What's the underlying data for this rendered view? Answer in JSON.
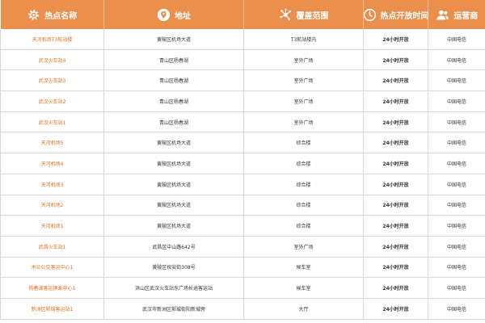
{
  "colors": {
    "header_bg": "#ea8f4c",
    "name_text": "#e46e1b",
    "body_text": "#333333",
    "border": "#d9d9d9"
  },
  "headers": [
    {
      "label": "热点名称",
      "icon": "gear-icon"
    },
    {
      "label": "地址",
      "icon": "location-pin-icon"
    },
    {
      "label": "覆盖范围",
      "icon": "coverage-network-icon"
    },
    {
      "label": "热点开放时间",
      "icon": "clock-icon"
    },
    {
      "label": "运营商",
      "icon": "users-icon"
    }
  ],
  "rows": [
    {
      "name": "天河机场T3航站楼",
      "address": "黄陂区机场大道",
      "coverage": "T3航站楼内",
      "hours": "24小时开放",
      "operator": "中国电信"
    },
    {
      "name": "武汉火车站4",
      "address": "青山区杨春湖",
      "coverage": "室外广场",
      "hours": "24小时开放",
      "operator": "中国电信"
    },
    {
      "name": "武汉火车站3",
      "address": "青山区杨春湖",
      "coverage": "室外广场",
      "hours": "24小时开放",
      "operator": "中国电信"
    },
    {
      "name": "武汉火车站2",
      "address": "青山区杨春湖",
      "coverage": "室外广场",
      "hours": "24小时开放",
      "operator": "中国电信"
    },
    {
      "name": "武汉火车站1",
      "address": "青山区杨春湖",
      "coverage": "室外广场",
      "hours": "24小时开放",
      "operator": "中国电信"
    },
    {
      "name": "天河机场5",
      "address": "黄陂区机场大道",
      "coverage": "综合楼",
      "hours": "24小时开放",
      "operator": "中国电信"
    },
    {
      "name": "天河机场4",
      "address": "黄陂区机场大道",
      "coverage": "综合楼",
      "hours": "24小时开放",
      "operator": "中国电信"
    },
    {
      "name": "天河机场3",
      "address": "黄陂区机场大道",
      "coverage": "综合楼",
      "hours": "24小时开放",
      "operator": "中国电信"
    },
    {
      "name": "天河机场2",
      "address": "黄陂区机场大道",
      "coverage": "综合楼",
      "hours": "24小时开放",
      "operator": "中国电信"
    },
    {
      "name": "天河机场1",
      "address": "黄陂区机场大道",
      "coverage": "综合楼",
      "hours": "24小时开放",
      "operator": "中国电信"
    },
    {
      "name": "武昌火车站1",
      "address": "武昌区中山路642号",
      "coverage": "室外广场",
      "hours": "24小时开放",
      "operator": "中国电信"
    },
    {
      "name": "木兰公交客运中心1",
      "address": "黄陂区祝安街308号",
      "coverage": "候车室",
      "hours": "24小时开放",
      "operator": "中国电信"
    },
    {
      "name": "杨春湖客运换乘中心1",
      "address": "洪山区武汉火车站东广场长途客运站",
      "coverage": "候车室",
      "hours": "24小时开放",
      "operator": "中国电信"
    },
    {
      "name": "新洲区邾城客运站1",
      "address": "武汉市新洲区邾城街阳新城旁",
      "coverage": "大厅",
      "hours": "24小时开放",
      "operator": "中国电信"
    }
  ]
}
